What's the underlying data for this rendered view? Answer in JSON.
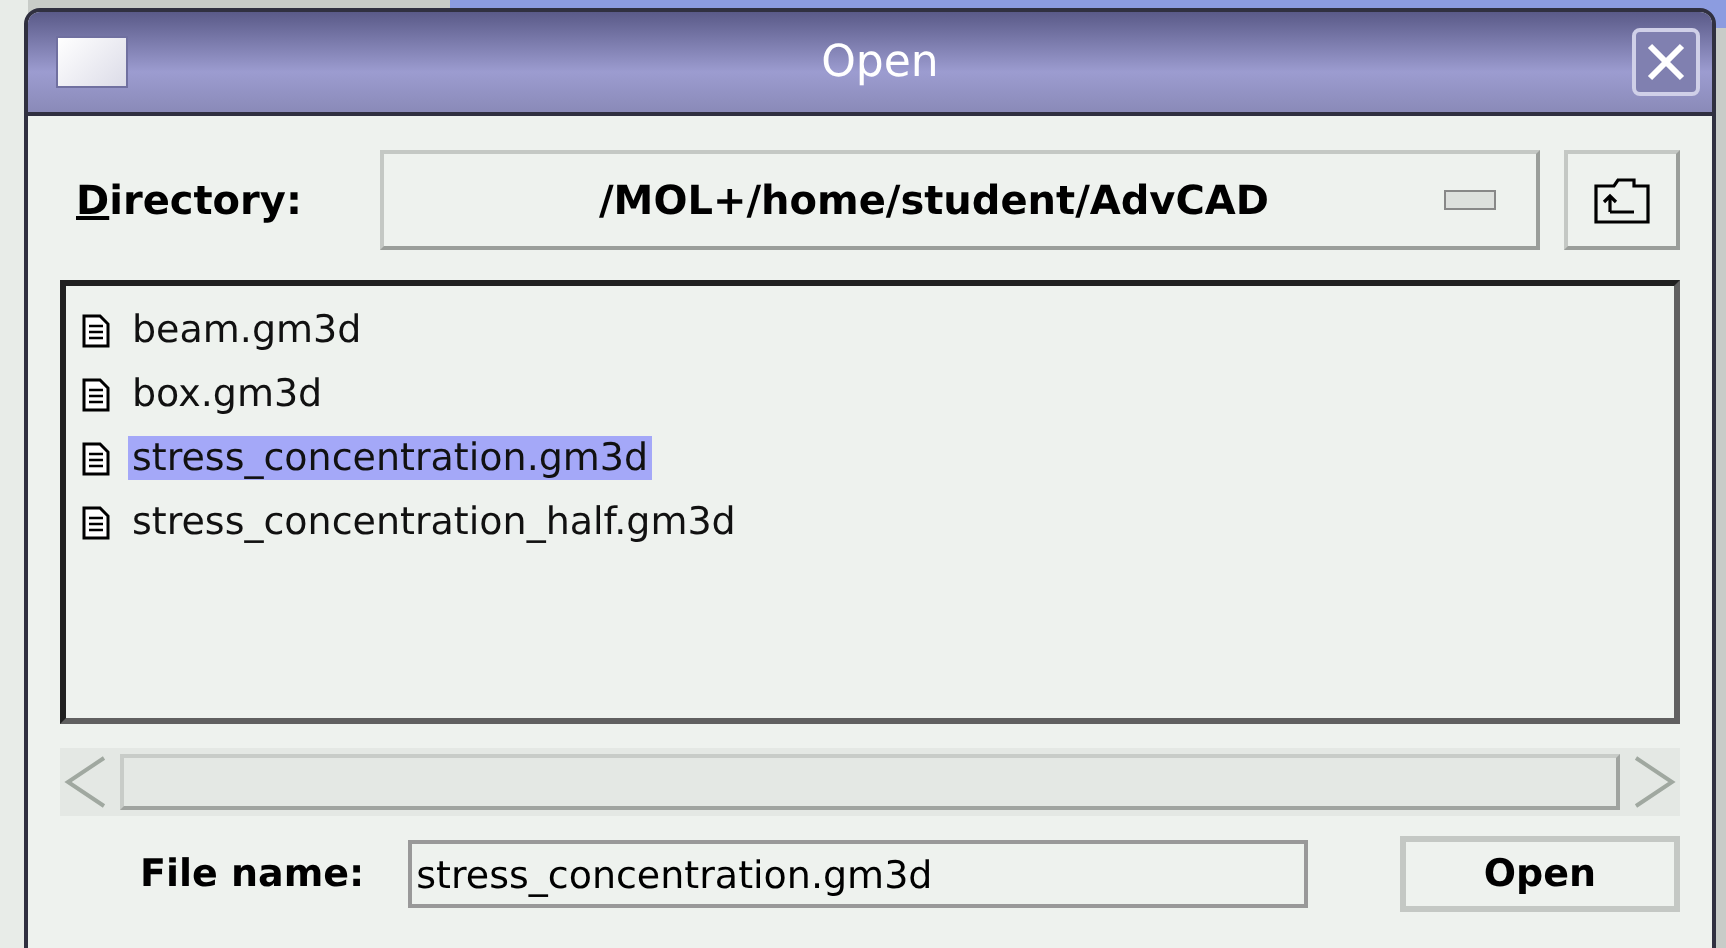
{
  "window": {
    "title": "Open"
  },
  "directory": {
    "label": "Directory:",
    "value": "/MOL+/home/student/AdvCAD"
  },
  "files": [
    {
      "name": "beam.gm3d",
      "selected": false
    },
    {
      "name": "box.gm3d",
      "selected": false
    },
    {
      "name": "stress_concentration.gm3d",
      "selected": true
    },
    {
      "name": "stress_concentration_half.gm3d",
      "selected": false
    }
  ],
  "file_name": {
    "label": "File name:",
    "value": "stress_concentration.gm3d"
  },
  "buttons": [
    "Open"
  ]
}
